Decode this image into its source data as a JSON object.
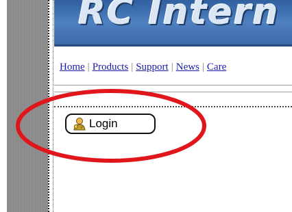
{
  "banner": {
    "title": "RC Intern"
  },
  "nav": {
    "items": [
      {
        "label": "Home"
      },
      {
        "label": "Products"
      },
      {
        "label": "Support"
      },
      {
        "label": "News"
      },
      {
        "label": "Care"
      }
    ],
    "separator": "|"
  },
  "login": {
    "label": "Login",
    "icon": "user-key-icon"
  },
  "annotation": {
    "color": "#e0161b"
  },
  "colors": {
    "banner": "#3a6aac",
    "link": "#1a1aa6",
    "side_strip": "#8c8c8c"
  }
}
